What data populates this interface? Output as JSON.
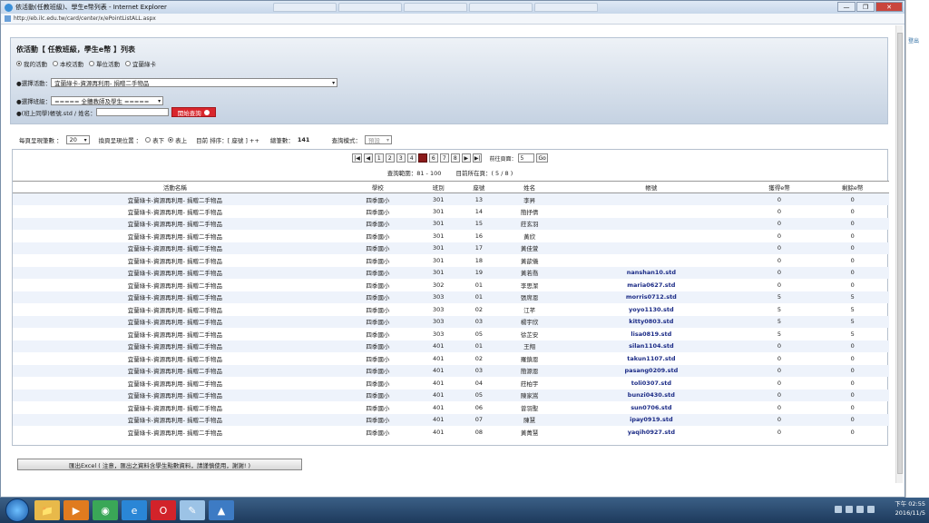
{
  "window": {
    "title": "依活動(任教班級)、學生e幣列表 - Internet Explorer",
    "url": "http://eb.ilc.edu.tw/card/center/x/ePointListALL.aspx",
    "controls": [
      "—",
      "❐",
      "✕"
    ]
  },
  "side_link": "登出",
  "page": {
    "title": "依活動【 任教班級，學生e幣 】列表",
    "scope_options": [
      {
        "label": "我的活動",
        "selected": true
      },
      {
        "label": "本校活動",
        "selected": false
      },
      {
        "label": "單位活動",
        "selected": false
      },
      {
        "label": "宜蘭綠卡",
        "selected": false
      }
    ],
    "activity_label": "●選擇活動",
    "activity_value": "宜蘭綠卡-資源再利用- 捐贈二手物品",
    "class_label": "●選擇班級",
    "class_value": "===== 全體教師及學生 =====",
    "search_label": "●(班上同學)帳號.std / 姓名：",
    "search_button": "開始查詢"
  },
  "options": {
    "per_page_label": "每頁呈現筆數 ：",
    "per_page_value": "20",
    "pager_pos_label": "換頁呈現位置 ：",
    "pos_down": "表下",
    "pos_up": "表上",
    "sort_text": "目前 排序：[ 座號 ] ++",
    "total_label": "總筆數：",
    "total_value": "141",
    "mode_label": "查詢模式：",
    "mode_value": "預設"
  },
  "pager": {
    "first": "|◀",
    "prev": "◀",
    "pages": [
      "1",
      "2",
      "3",
      "4",
      "5",
      "6",
      "7",
      "8"
    ],
    "current_index": 4,
    "next": "▶",
    "last": "▶|",
    "goto_label": "前往頁面：",
    "goto_value": "5",
    "goto_button": "Go"
  },
  "range": {
    "text": "查詢範圍：81 - 100",
    "page_text": "目前所在頁：( 5 / 8 )"
  },
  "table": {
    "headers": [
      "活動名稱",
      "學校",
      "班別",
      "座號",
      "姓名",
      "帳號",
      "獲得e幣",
      "剩餘e幣"
    ],
    "rows": [
      [
        "宜蘭綠卡-資源再利用- 捐贈二手物品",
        "四季國小",
        "301",
        "13",
        "李昇",
        "",
        "0",
        "0"
      ],
      [
        "宜蘭綠卡-資源再利用- 捐贈二手物品",
        "四季國小",
        "301",
        "14",
        "簡抒倩",
        "",
        "0",
        "0"
      ],
      [
        "宜蘭綠卡-資源再利用- 捐贈二手物品",
        "四季國小",
        "301",
        "15",
        "莊玄羽",
        "",
        "0",
        "0"
      ],
      [
        "宜蘭綠卡-資源再利用- 捐贈二手物品",
        "四季國小",
        "301",
        "16",
        "黃欣",
        "",
        "0",
        "0"
      ],
      [
        "宜蘭綠卡-資源再利用- 捐贈二手物品",
        "四季國小",
        "301",
        "17",
        "黃佳萱",
        "",
        "0",
        "0"
      ],
      [
        "宜蘭綠卡-資源再利用- 捐贈二手物品",
        "四季國小",
        "301",
        "18",
        "黃歆儀",
        "",
        "0",
        "0"
      ],
      [
        "宜蘭綠卡-資源再利用- 捐贈二手物品",
        "四季國小",
        "301",
        "19",
        "黃若喬",
        "nanshan10.std",
        "0",
        "0"
      ],
      [
        "宜蘭綠卡-資源再利用- 捐贈二手物品",
        "四季國小",
        "302",
        "01",
        "李思潔",
        "maria0627.std",
        "0",
        "0"
      ],
      [
        "宜蘭綠卡-資源再利用- 捐贈二手物品",
        "四季國小",
        "303",
        "01",
        "張席恩",
        "morris0712.std",
        "5",
        "5"
      ],
      [
        "宜蘭綠卡-資源再利用- 捐贈二手物品",
        "四季國小",
        "303",
        "02",
        "江芊",
        "yoyo1130.std",
        "5",
        "5"
      ],
      [
        "宜蘭綠卡-資源再利用- 捐贈二手物品",
        "四季國小",
        "303",
        "03",
        "楊宇欣",
        "kitty0803.std",
        "5",
        "5"
      ],
      [
        "宜蘭綠卡-資源再利用- 捐贈二手物品",
        "四季國小",
        "303",
        "05",
        "徐芷安",
        "lisa0819.std",
        "5",
        "5"
      ],
      [
        "宜蘭綠卡-資源再利用- 捐贈二手物品",
        "四季國小",
        "401",
        "01",
        "王翔",
        "silan1104.std",
        "0",
        "0"
      ],
      [
        "宜蘭綠卡-資源再利用- 捐贈二手物品",
        "四季國小",
        "401",
        "02",
        "羅鎮恩",
        "takun1107.std",
        "0",
        "0"
      ],
      [
        "宜蘭綠卡-資源再利用- 捐贈二手物品",
        "四季國小",
        "401",
        "03",
        "簡源恩",
        "pasang0209.std",
        "0",
        "0"
      ],
      [
        "宜蘭綠卡-資源再利用- 捐贈二手物品",
        "四季國小",
        "401",
        "04",
        "莊柏宇",
        "toli0307.std",
        "0",
        "0"
      ],
      [
        "宜蘭綠卡-資源再利用- 捐贈二手物品",
        "四季國小",
        "401",
        "05",
        "陳家嵩",
        "bunzi0430.std",
        "0",
        "0"
      ],
      [
        "宜蘭綠卡-資源再利用- 捐贈二手物品",
        "四季國小",
        "401",
        "06",
        "曾羽聖",
        "sun0706.std",
        "0",
        "0"
      ],
      [
        "宜蘭綠卡-資源再利用- 捐贈二手物品",
        "四季國小",
        "401",
        "07",
        "陳慧",
        "ipay0919.std",
        "0",
        "0"
      ],
      [
        "宜蘭綠卡-資源再利用- 捐贈二手物品",
        "四季國小",
        "401",
        "08",
        "黃菁慧",
        "yaqih0927.std",
        "0",
        "0"
      ]
    ]
  },
  "excel_button": "匯出Excel ( 注意，匯出之資料含學生點數資料，請謹慎使用，謝謝! )",
  "taskbar": {
    "apps": [
      {
        "name": "folder-icon",
        "glyph": "📁",
        "color": "#e8b94a"
      },
      {
        "name": "media-player-icon",
        "glyph": "▶",
        "color": "#e07b1f"
      },
      {
        "name": "chrome-icon",
        "glyph": "◉",
        "color": "#3aa757"
      },
      {
        "name": "ie-icon",
        "glyph": "e",
        "color": "#2a86d6"
      },
      {
        "name": "opera-icon",
        "glyph": "O",
        "color": "#d2232a"
      },
      {
        "name": "paint-icon",
        "glyph": "✎",
        "color": "#9cc3e6"
      },
      {
        "name": "app-icon",
        "glyph": "▲",
        "color": "#3d7bc4"
      }
    ],
    "time": "下午 02:55",
    "date": "2016/11/5"
  }
}
